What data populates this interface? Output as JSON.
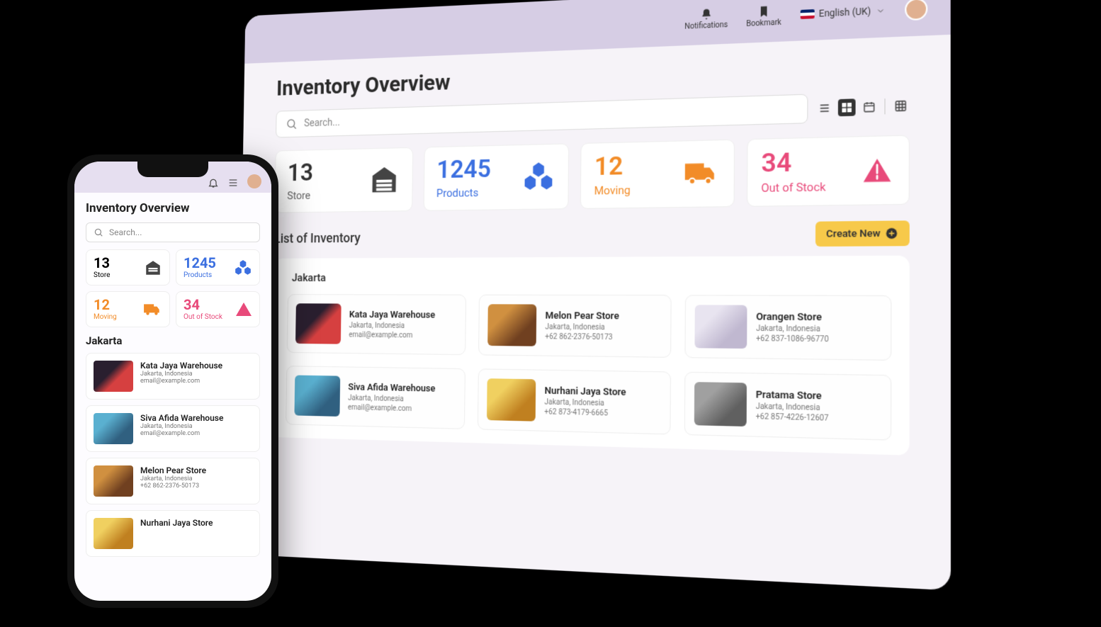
{
  "topbar": {
    "notifications_label": "Notifications",
    "bookmark_label": "Bookmark",
    "language": "English (UK)"
  },
  "page": {
    "title": "Inventory Overview",
    "search_placeholder": "Search...",
    "list_title": "List of Inventory",
    "create_new_label": "Create New",
    "region": "Jakarta"
  },
  "stats": {
    "store": {
      "value": "13",
      "label": "Store"
    },
    "products": {
      "value": "1245",
      "label": "Products"
    },
    "moving": {
      "value": "12",
      "label": "Moving"
    },
    "out_of_stock": {
      "value": "34",
      "label": "Out of Stock"
    }
  },
  "desktop_cards": [
    {
      "name": "Kata Jaya Warehouse",
      "location": "Jakarta, Indonesia",
      "contact": "email@example.com"
    },
    {
      "name": "Melon Pear Store",
      "location": "Jakarta, Indonesia",
      "contact": "+62 862-2376-50173"
    },
    {
      "name": "Orangen Store",
      "location": "Jakarta, Indonesia",
      "contact": "+62 837-1086-96770"
    },
    {
      "name": "Siva Afida Warehouse",
      "location": "Jakarta, Indonesia",
      "contact": "email@example.com"
    },
    {
      "name": "Nurhani Jaya Store",
      "location": "Jakarta, Indonesia",
      "contact": "+62 873-4179-6665"
    },
    {
      "name": "Pratama Store",
      "location": "Jakarta, Indonesia",
      "contact": "+62 857-4226-12607"
    }
  ],
  "mobile_cards": [
    {
      "name": "Kata Jaya Warehouse",
      "location": "Jakarta, Indonesia",
      "contact": "email@example.com"
    },
    {
      "name": "Siva Afida Warehouse",
      "location": "Jakarta, Indonesia",
      "contact": "email@example.com"
    },
    {
      "name": "Melon Pear Store",
      "location": "Jakarta, Indonesia",
      "contact": "+62 862-2376-50173"
    },
    {
      "name": "Nurhani Jaya Store",
      "location": "",
      "contact": ""
    }
  ]
}
